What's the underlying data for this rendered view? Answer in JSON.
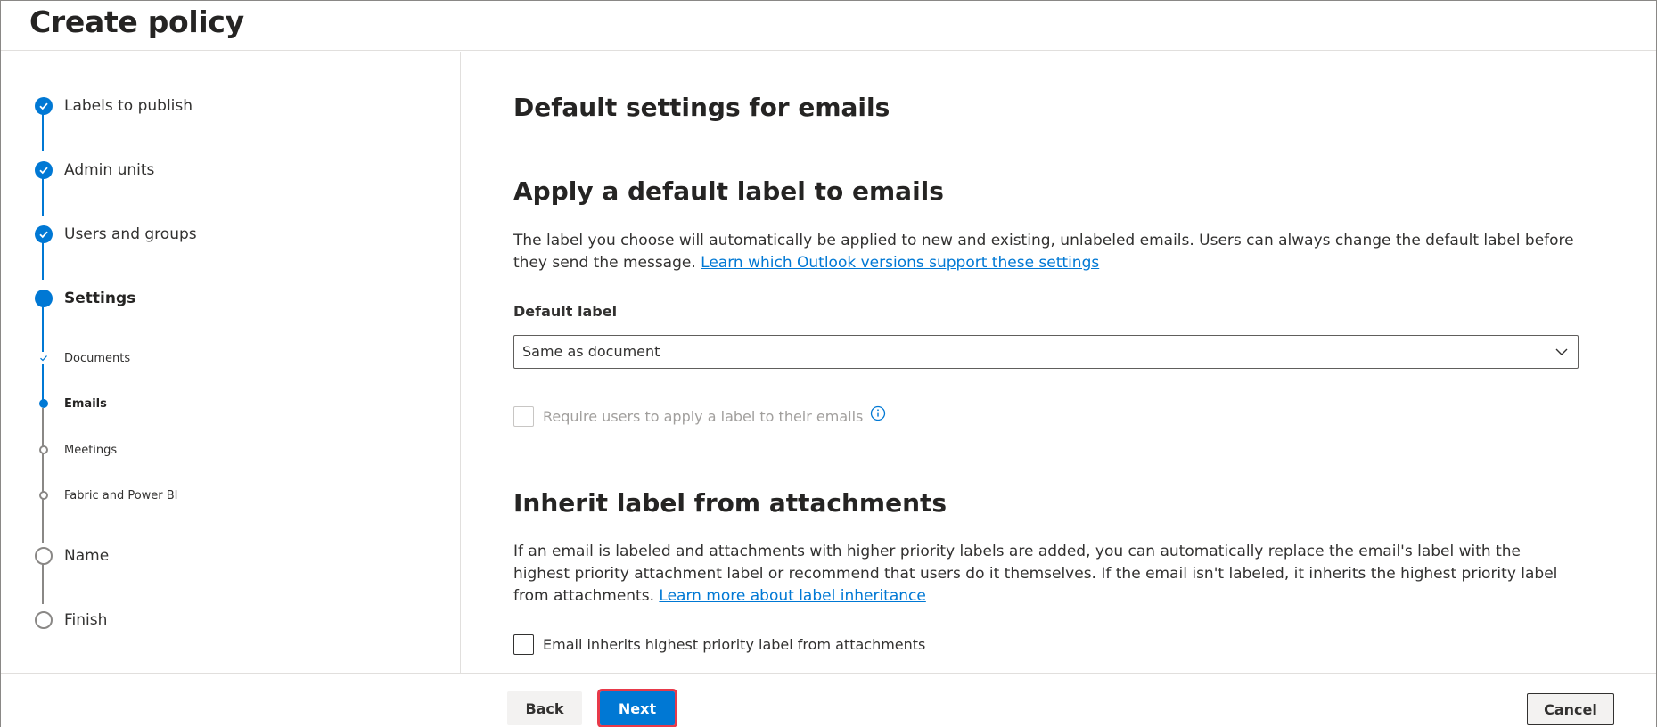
{
  "header": {
    "title": "Create policy"
  },
  "steps": [
    {
      "label": "Labels to publish",
      "state": "done"
    },
    {
      "label": "Admin units",
      "state": "done"
    },
    {
      "label": "Users and groups",
      "state": "done"
    },
    {
      "label": "Settings",
      "state": "current"
    },
    {
      "label": "Documents",
      "state": "sub-done"
    },
    {
      "label": "Emails",
      "state": "sub-current"
    },
    {
      "label": "Meetings",
      "state": "sub-todo"
    },
    {
      "label": "Fabric and Power BI",
      "state": "sub-todo"
    },
    {
      "label": "Name",
      "state": "todo"
    },
    {
      "label": "Finish",
      "state": "todo"
    }
  ],
  "main": {
    "title": "Default settings for emails",
    "default_label_section": {
      "heading": "Apply a default label to emails",
      "description": "The label you choose will automatically be applied to new and existing, unlabeled emails. Users can always change the default label before they send the message.",
      "link": "Learn which Outlook versions support these settings",
      "field_label": "Default label",
      "selected_value": "Same as document",
      "require_checkbox_label": "Require users to apply a label to their emails",
      "require_checked": false
    },
    "inherit_section": {
      "heading": "Inherit label from attachments",
      "description": "If an email is labeled and attachments with higher priority labels are added, you can automatically replace the email's label with the highest priority attachment label or recommend that users do it themselves. If the email isn't labeled, it inherits the highest priority label from attachments.",
      "link": "Learn more about label inheritance",
      "checkbox_label": "Email inherits highest priority label from attachments",
      "checked": false
    }
  },
  "footer": {
    "back_label": "Back",
    "next_label": "Next",
    "cancel_label": "Cancel"
  },
  "colors": {
    "accent": "#0078d4",
    "highlight_border": "#e83a4a"
  }
}
